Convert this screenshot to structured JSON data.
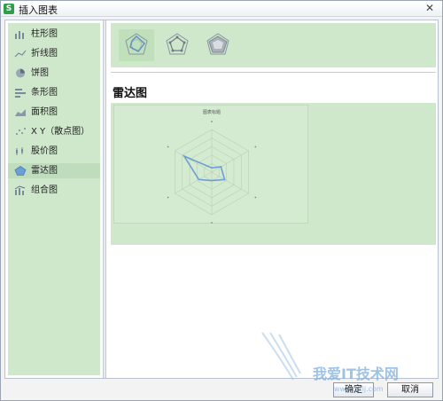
{
  "window": {
    "title": "插入图表",
    "app_icon_letter": "S",
    "close_symbol": "✕"
  },
  "sidebar": {
    "items": [
      {
        "label": "柱形图",
        "icon": "column-chart-icon",
        "selected": false
      },
      {
        "label": "折线图",
        "icon": "line-chart-icon",
        "selected": false
      },
      {
        "label": "饼图",
        "icon": "pie-chart-icon",
        "selected": false
      },
      {
        "label": "条形图",
        "icon": "bar-chart-icon",
        "selected": false
      },
      {
        "label": "面积图",
        "icon": "area-chart-icon",
        "selected": false
      },
      {
        "label": "X Y（散点图）",
        "icon": "scatter-chart-icon",
        "selected": false
      },
      {
        "label": "股价图",
        "icon": "stock-chart-icon",
        "selected": false
      },
      {
        "label": "雷达图",
        "icon": "radar-chart-icon",
        "selected": true
      },
      {
        "label": "组合图",
        "icon": "combo-chart-icon",
        "selected": false
      }
    ]
  },
  "content": {
    "section_title": "雷达图",
    "subtypes": [
      {
        "icon": "radar-icon",
        "selected": true
      },
      {
        "icon": "radar-markers-icon",
        "selected": false
      },
      {
        "icon": "radar-filled-icon",
        "selected": false
      }
    ],
    "preview": {
      "chart_title": "图表标题"
    }
  },
  "chart_data": {
    "type": "radar",
    "title": "图表标题",
    "axes_count": 6,
    "series": [
      {
        "values": [
          0.1,
          0.25,
          0.35,
          0.2,
          0.35,
          0.75
        ]
      }
    ],
    "color": "#6b9fd4"
  },
  "footer": {
    "ok_label": "确定",
    "cancel_label": "取消"
  },
  "watermark": {
    "text": "我爱IT技术网",
    "url": "www.52ij.com"
  },
  "colors": {
    "panel_green": "#cfe8cc",
    "selected_green": "#bfdcbc",
    "series_blue": "#6b9fd4"
  }
}
